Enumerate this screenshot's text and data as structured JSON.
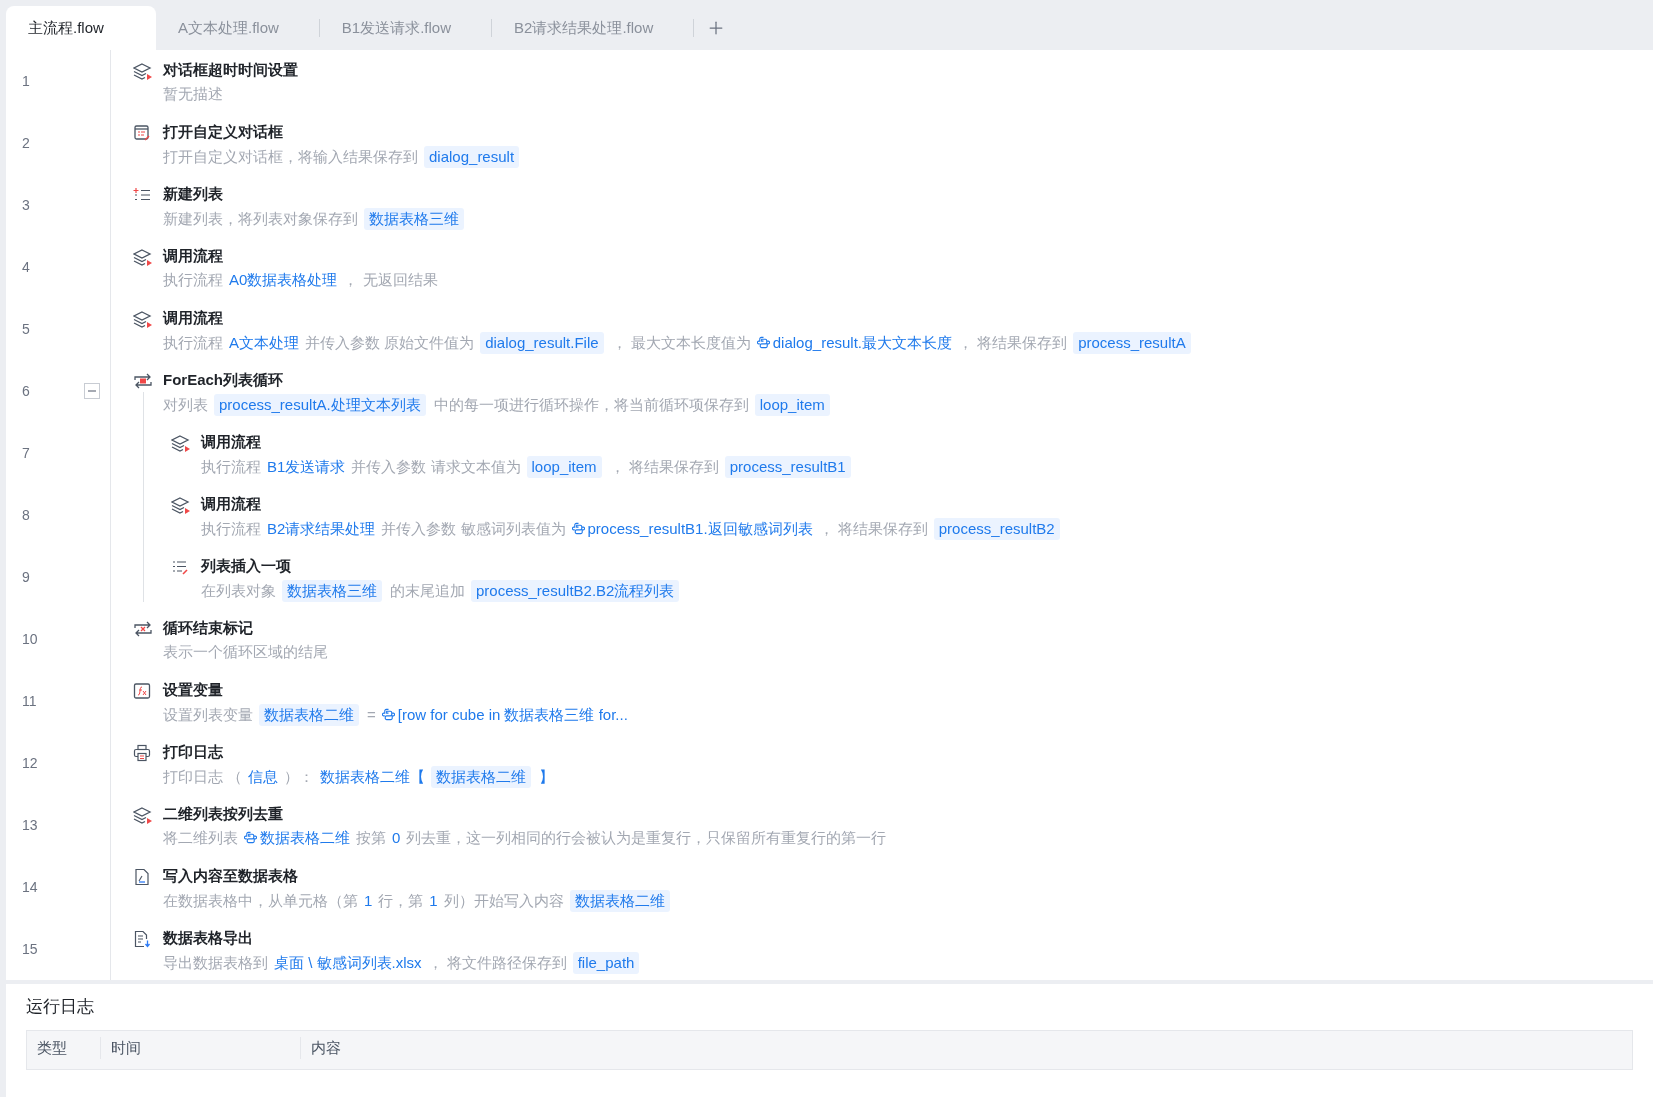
{
  "tabs": [
    {
      "label": "主流程.flow",
      "selected": true
    },
    {
      "label": "A文本处理.flow",
      "selected": false
    },
    {
      "label": "B1发送请求.flow",
      "selected": false
    },
    {
      "label": "B2请求结果处理.flow",
      "selected": false
    }
  ],
  "steps": [
    {
      "line": "1",
      "kind": "flow",
      "title": "对话框超时时间设置",
      "description": [
        {
          "kind": "text",
          "text": "暂无描述"
        }
      ]
    },
    {
      "line": "2",
      "kind": "dialog",
      "title": "打开自定义对话框",
      "description": [
        {
          "kind": "text",
          "text": "打开自定义对话框，将输入结果保存到"
        },
        {
          "kind": "var",
          "text": "dialog_result"
        }
      ]
    },
    {
      "line": "3",
      "kind": "new-list",
      "title": "新建列表",
      "description": [
        {
          "kind": "text",
          "text": "新建列表，将列表对象保存到"
        },
        {
          "kind": "var",
          "text": "数据表格三维"
        }
      ]
    },
    {
      "line": "4",
      "kind": "flow",
      "title": "调用流程",
      "description": [
        {
          "kind": "text",
          "text": "执行流程"
        },
        {
          "kind": "link",
          "text": "A0数据表格处理"
        },
        {
          "kind": "text",
          "text": "， 无返回结果"
        }
      ]
    },
    {
      "line": "5",
      "kind": "flow",
      "title": "调用流程",
      "description": [
        {
          "kind": "text",
          "text": "执行流程"
        },
        {
          "kind": "link",
          "text": "A文本处理"
        },
        {
          "kind": "text",
          "text": "并传入参数 原始文件值为"
        },
        {
          "kind": "var",
          "text": "dialog_result.File"
        },
        {
          "kind": "text",
          "text": "，  最大文本长度值为"
        },
        {
          "kind": "expr",
          "text": "dialog_result.最大文本长度"
        },
        {
          "kind": "text",
          "text": "，  将结果保存到"
        },
        {
          "kind": "var",
          "text": "process_resultA"
        }
      ]
    },
    {
      "line": "6",
      "kind": "foreach",
      "title": "ForEach列表循环",
      "expanded": true,
      "description": [
        {
          "kind": "text",
          "text": "对列表"
        },
        {
          "kind": "var",
          "text": "process_resultA.处理文本列表"
        },
        {
          "kind": "text",
          "text": "中的每一项进行循环操作，将当前循环项保存到"
        },
        {
          "kind": "var",
          "text": "loop_item"
        }
      ],
      "children": [
        {
          "line": "7",
          "kind": "flow",
          "title": "调用流程",
          "description": [
            {
              "kind": "text",
              "text": "执行流程"
            },
            {
              "kind": "link",
              "text": "B1发送请求"
            },
            {
              "kind": "text",
              "text": "并传入参数 请求文本值为"
            },
            {
              "kind": "var",
              "text": "loop_item"
            },
            {
              "kind": "text",
              "text": "，  将结果保存到"
            },
            {
              "kind": "var",
              "text": "process_resultB1"
            }
          ]
        },
        {
          "line": "8",
          "kind": "flow",
          "title": "调用流程",
          "description": [
            {
              "kind": "text",
              "text": "执行流程"
            },
            {
              "kind": "link",
              "text": "B2请求结果处理"
            },
            {
              "kind": "text",
              "text": "并传入参数 敏感词列表值为"
            },
            {
              "kind": "expr",
              "text": "process_resultB1.返回敏感词列表"
            },
            {
              "kind": "text",
              "text": "，  将结果保存到"
            },
            {
              "kind": "var",
              "text": "process_resultB2"
            }
          ]
        },
        {
          "line": "9",
          "kind": "insert",
          "title": "列表插入一项",
          "description": [
            {
              "kind": "text",
              "text": "在列表对象"
            },
            {
              "kind": "var",
              "text": "数据表格三维"
            },
            {
              "kind": "text",
              "text": "的末尾追加"
            },
            {
              "kind": "var",
              "text": "process_resultB2.B2流程列表"
            }
          ]
        }
      ]
    },
    {
      "line": "10",
      "kind": "loop-end",
      "title": "循环结束标记",
      "description": [
        {
          "kind": "text",
          "text": "表示一个循环区域的结尾"
        }
      ]
    },
    {
      "line": "11",
      "kind": "set-var",
      "title": "设置变量",
      "description": [
        {
          "kind": "text",
          "text": "设置列表变量"
        },
        {
          "kind": "var",
          "text": "数据表格二维"
        },
        {
          "kind": "text",
          "text": "="
        },
        {
          "kind": "expr",
          "text": "[row for cube in 数据表格三维 for..."
        }
      ]
    },
    {
      "line": "12",
      "kind": "print",
      "title": "打印日志",
      "description": [
        {
          "kind": "text",
          "text": "打印日志 （"
        },
        {
          "kind": "link",
          "text": "信息"
        },
        {
          "kind": "text",
          "text": "）："
        },
        {
          "kind": "link",
          "text": "数据表格二维【"
        },
        {
          "kind": "var",
          "text": "数据表格二维"
        },
        {
          "kind": "link",
          "text": "】"
        }
      ]
    },
    {
      "line": "13",
      "kind": "flow",
      "title": "二维列表按列去重",
      "description": [
        {
          "kind": "text",
          "text": "将二维列表"
        },
        {
          "kind": "expr",
          "text": "数据表格二维"
        },
        {
          "kind": "text",
          "text": "按第"
        },
        {
          "kind": "link",
          "text": "0"
        },
        {
          "kind": "text",
          "text": "列去重，这一列相同的行会被认为是重复行，只保留所有重复行的第一行"
        }
      ]
    },
    {
      "line": "14",
      "kind": "write",
      "title": "写入内容至数据表格",
      "description": [
        {
          "kind": "text",
          "text": "在数据表格中，从单元格（第"
        },
        {
          "kind": "link",
          "text": "1"
        },
        {
          "kind": "text",
          "text": "行，第"
        },
        {
          "kind": "link",
          "text": "1"
        },
        {
          "kind": "text",
          "text": "列）开始写入内容"
        },
        {
          "kind": "var",
          "text": "数据表格二维"
        }
      ]
    },
    {
      "line": "15",
      "kind": "export",
      "title": "数据表格导出",
      "description": [
        {
          "kind": "text",
          "text": "导出数据表格到"
        },
        {
          "kind": "link",
          "text": "桌面 \\ 敏感词列表.xlsx"
        },
        {
          "kind": "text",
          "text": "，  将文件路径保存到"
        },
        {
          "kind": "var",
          "text": "file_path"
        }
      ]
    }
  ],
  "log_panel": {
    "title": "运行日志",
    "columns": [
      "类型",
      "时间",
      "内容"
    ]
  }
}
